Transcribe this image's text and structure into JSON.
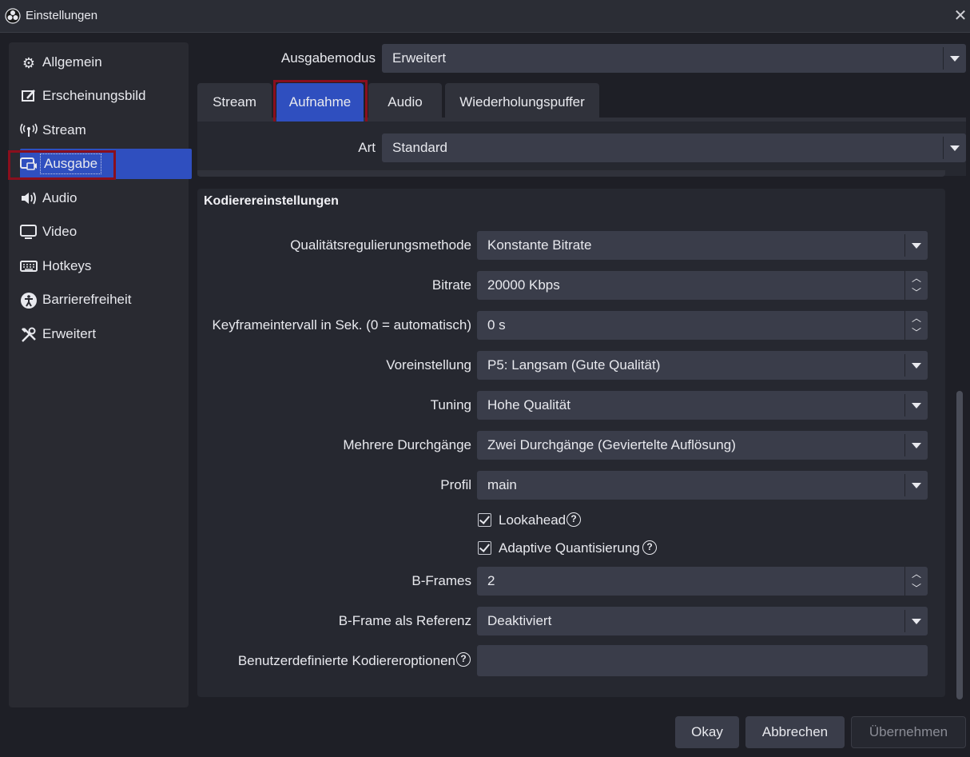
{
  "window": {
    "title": "Einstellungen"
  },
  "sidebar": {
    "items": [
      {
        "label": "Allgemein",
        "icon": "gear-icon"
      },
      {
        "label": "Erscheinungsbild",
        "icon": "appearance-icon"
      },
      {
        "label": "Stream",
        "icon": "broadcast-icon"
      },
      {
        "label": "Ausgabe",
        "icon": "output-icon",
        "active": true
      },
      {
        "label": "Audio",
        "icon": "speaker-icon"
      },
      {
        "label": "Video",
        "icon": "monitor-icon"
      },
      {
        "label": "Hotkeys",
        "icon": "keyboard-icon"
      },
      {
        "label": "Barrierefreiheit",
        "icon": "accessibility-icon"
      },
      {
        "label": "Erweitert",
        "icon": "tools-icon"
      }
    ]
  },
  "output_mode": {
    "label": "Ausgabemodus",
    "value": "Erweitert"
  },
  "tabs": [
    {
      "label": "Stream"
    },
    {
      "label": "Aufnahme",
      "active": true
    },
    {
      "label": "Audio"
    },
    {
      "label": "Wiederholungspuffer"
    }
  ],
  "type": {
    "label": "Art",
    "value": "Standard"
  },
  "encoder": {
    "title": "Kodierereinstellungen",
    "rate_control": {
      "label": "Qualitätsregulierungsmethode",
      "value": "Konstante Bitrate"
    },
    "bitrate": {
      "label": "Bitrate",
      "value": "20000 Kbps"
    },
    "keyframe": {
      "label": "Keyframeintervall in Sek. (0 = automatisch)",
      "value": "0 s"
    },
    "preset": {
      "label": "Voreinstellung",
      "value": "P5: Langsam (Gute Qualität)"
    },
    "tuning": {
      "label": "Tuning",
      "value": "Hohe Qualität"
    },
    "multipass": {
      "label": "Mehrere Durchgänge",
      "value": "Zwei Durchgänge (Geviertelte Auflösung)"
    },
    "profile": {
      "label": "Profil",
      "value": "main"
    },
    "lookahead": {
      "label": "Lookahead",
      "checked": true
    },
    "adaptive_quant": {
      "label": "Adaptive Quantisierung",
      "checked": true
    },
    "bframes": {
      "label": "B-Frames",
      "value": "2"
    },
    "bframe_ref": {
      "label": "B-Frame als Referenz",
      "value": "Deaktiviert"
    },
    "custom_opts": {
      "label": "Benutzerdefinierte Kodiereroptionen",
      "value": ""
    }
  },
  "buttons": {
    "ok": "Okay",
    "cancel": "Abbrechen",
    "apply": "Übernehmen"
  },
  "colors": {
    "accent": "#2f4fbf",
    "highlight_border": "#8a0f1d",
    "background": "#1e1f26",
    "panel": "#292a31"
  }
}
